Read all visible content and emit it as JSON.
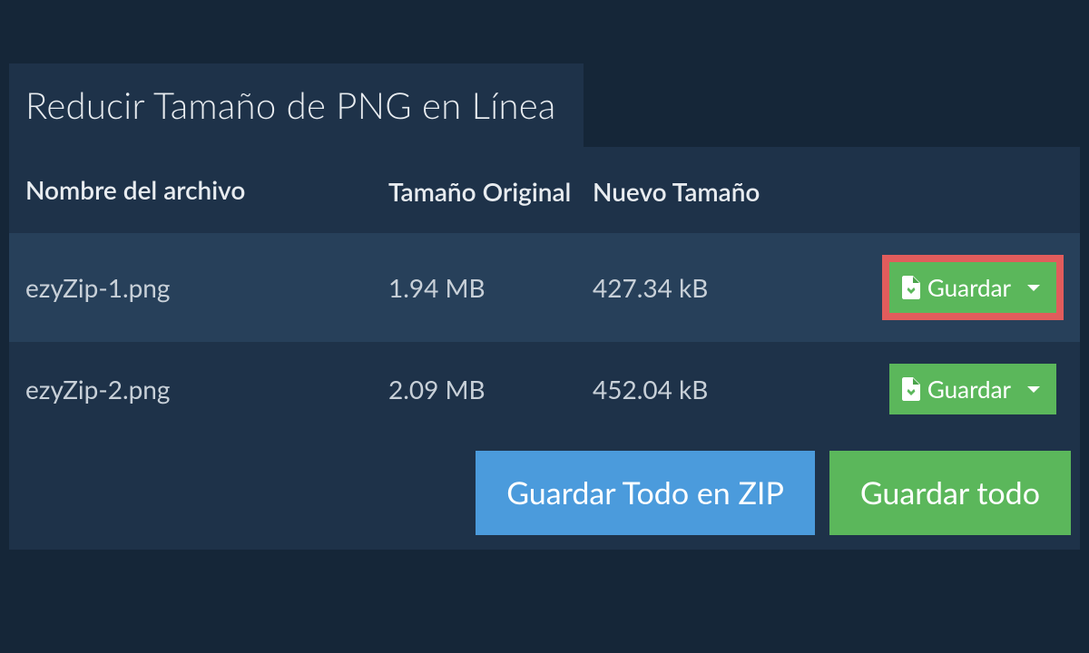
{
  "header": {
    "title": "Reducir Tamaño de PNG en Línea"
  },
  "table": {
    "columns": {
      "filename": "Nombre del archivo",
      "original": "Tamaño Original",
      "new": "Nuevo Tamaño"
    },
    "rows": [
      {
        "filename": "ezyZip-1.png",
        "original": "1.94 MB",
        "new": "427.34 kB",
        "save_label": "Guardar",
        "highlighted": true
      },
      {
        "filename": "ezyZip-2.png",
        "original": "2.09 MB",
        "new": "452.04 kB",
        "save_label": "Guardar",
        "highlighted": false
      }
    ]
  },
  "footer": {
    "save_zip": "Guardar Todo en ZIP",
    "save_all": "Guardar todo"
  }
}
